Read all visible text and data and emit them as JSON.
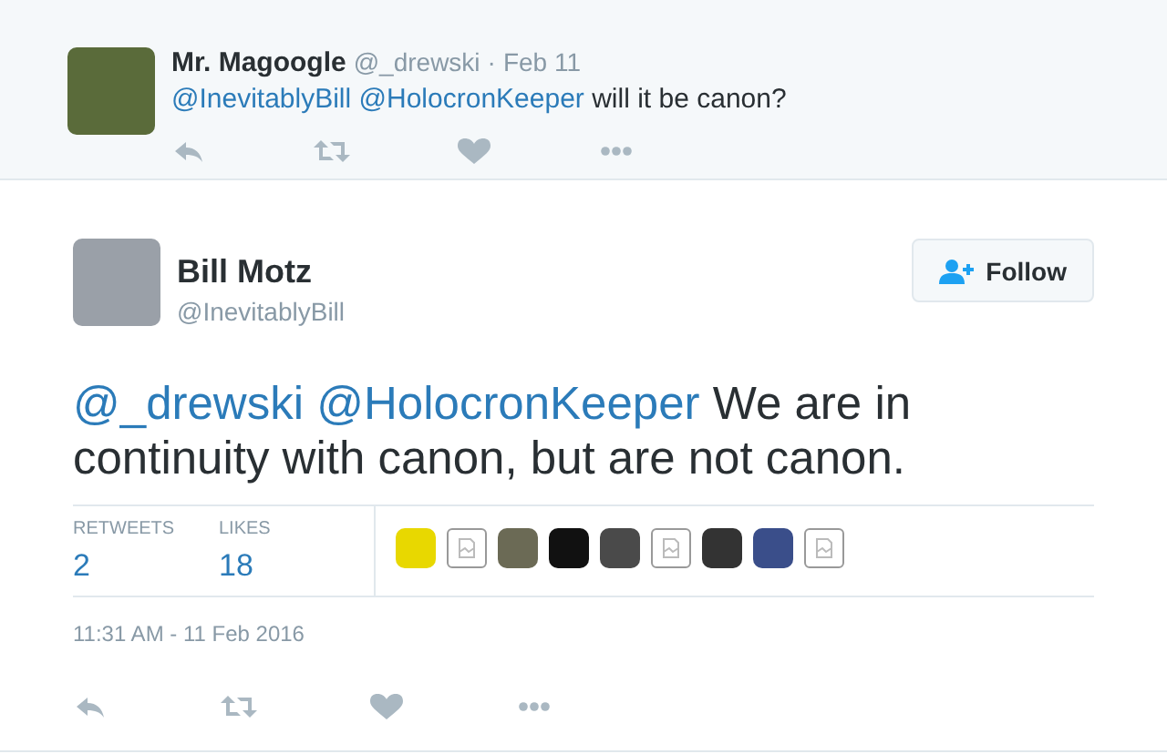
{
  "reply": {
    "name": "Mr. Magoogle",
    "handle": "@_drewski",
    "separator": "·",
    "date": "Feb 11",
    "text": [
      {
        "kind": "mention",
        "text": "@InevitablyBill"
      },
      {
        "kind": "mention",
        "text": "@HolocronKeeper"
      },
      {
        "kind": "text",
        "text": "will it be canon?"
      }
    ]
  },
  "tweet": {
    "name": "Bill Motz",
    "handle": "@InevitablyBill",
    "follow": "Follow",
    "text": [
      {
        "kind": "mention",
        "text": "@_drewski"
      },
      {
        "kind": "mention",
        "text": "@HolocronKeeper"
      },
      {
        "kind": "text",
        "text": "We are in continuity with canon, but are not canon."
      }
    ],
    "stats": [
      {
        "label": "RETWEETS",
        "value": "2"
      },
      {
        "label": "LIKES",
        "value": "18"
      }
    ],
    "likers": [
      {
        "kind": "photo",
        "color": "#e8d800"
      },
      {
        "kind": "broken"
      },
      {
        "kind": "photo",
        "color": "#6b6a55"
      },
      {
        "kind": "photo",
        "color": "#111111"
      },
      {
        "kind": "photo",
        "color": "#4a4a4a"
      },
      {
        "kind": "broken"
      },
      {
        "kind": "photo",
        "color": "#333333"
      },
      {
        "kind": "photo",
        "color": "#3a4e8a"
      },
      {
        "kind": "broken"
      }
    ],
    "timestamp": "11:31 AM - 11 Feb 2016"
  }
}
